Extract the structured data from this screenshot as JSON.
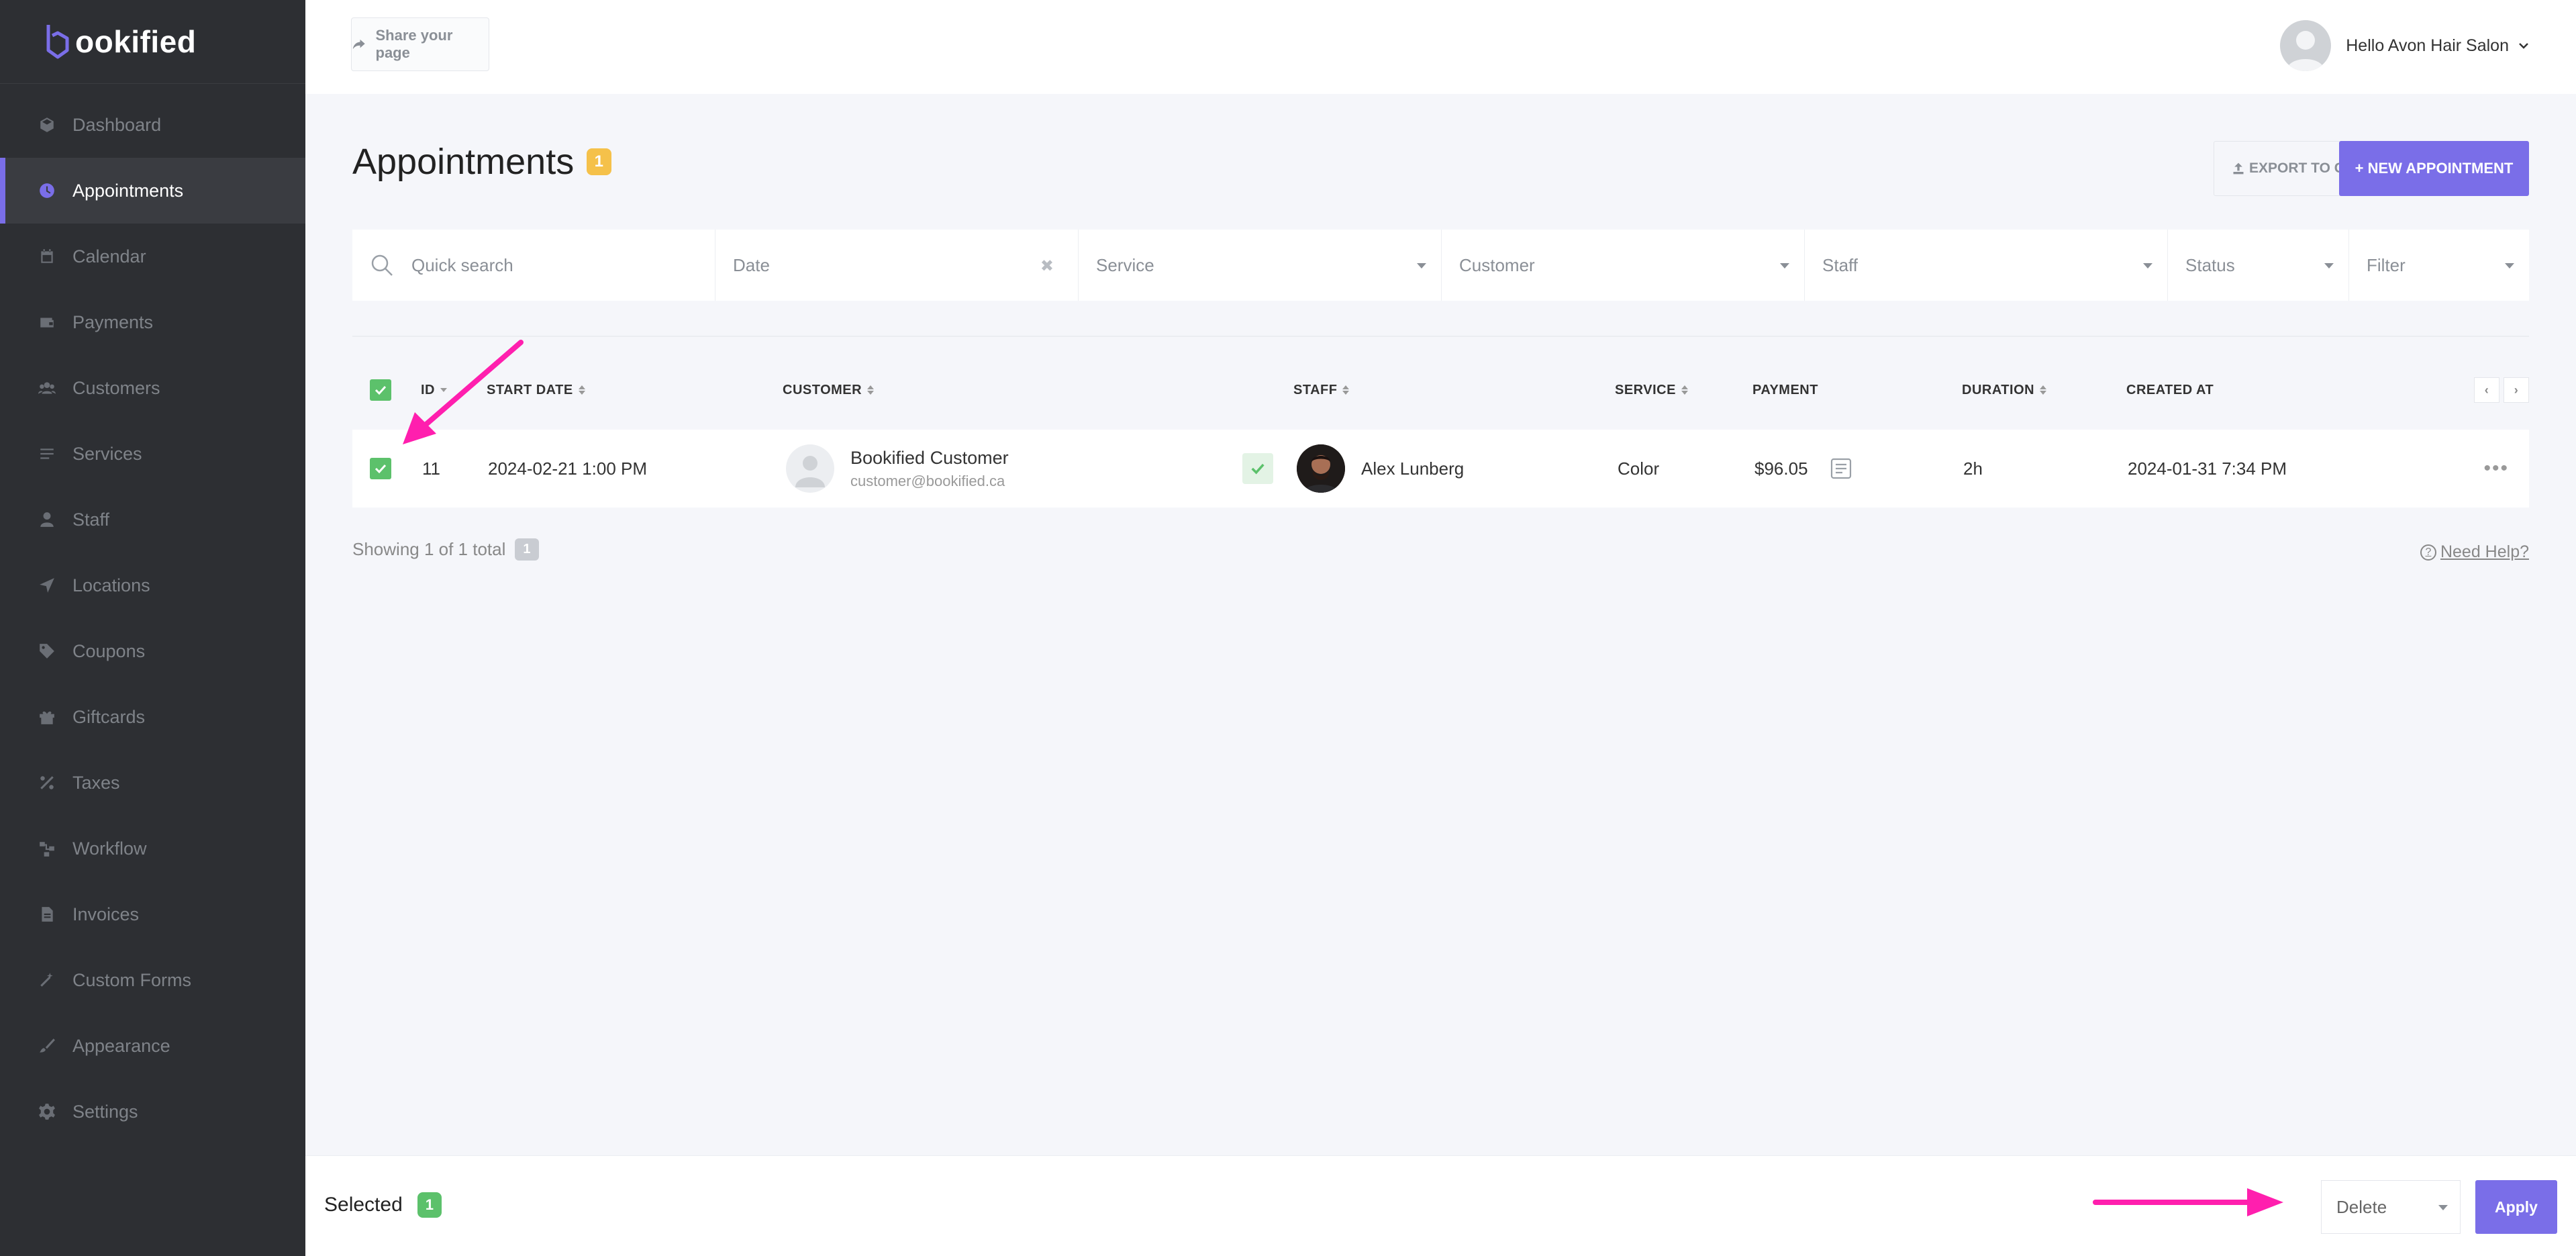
{
  "app": {
    "logo_text": "ookified",
    "brand_color": "#7a6ee8"
  },
  "sidebar": {
    "items": [
      {
        "label": "Dashboard",
        "icon": "cube-icon"
      },
      {
        "label": "Appointments",
        "icon": "clock-icon",
        "active": true
      },
      {
        "label": "Calendar",
        "icon": "calendar-icon"
      },
      {
        "label": "Payments",
        "icon": "wallet-icon"
      },
      {
        "label": "Customers",
        "icon": "users-icon"
      },
      {
        "label": "Services",
        "icon": "list-icon"
      },
      {
        "label": "Staff",
        "icon": "user-icon"
      },
      {
        "label": "Locations",
        "icon": "location-arrow-icon"
      },
      {
        "label": "Coupons",
        "icon": "tag-icon"
      },
      {
        "label": "Giftcards",
        "icon": "gift-icon"
      },
      {
        "label": "Taxes",
        "icon": "percent-icon"
      },
      {
        "label": "Workflow",
        "icon": "workflow-icon"
      },
      {
        "label": "Invoices",
        "icon": "file-icon"
      },
      {
        "label": "Custom Forms",
        "icon": "magic-wand-icon"
      },
      {
        "label": "Appearance",
        "icon": "brush-icon"
      },
      {
        "label": "Settings",
        "icon": "gear-icon"
      }
    ]
  },
  "topbar": {
    "share_label": "Share your page",
    "user_greeting": "Hello Avon Hair Salon"
  },
  "page": {
    "title": "Appointments",
    "count": "1",
    "export_label": "EXPORT TO CSV",
    "new_label": "+ NEW APPOINTMENT"
  },
  "filters": {
    "search_placeholder": "Quick search",
    "date_placeholder": "Date",
    "date_clear": "✖",
    "service": "Service",
    "customer": "Customer",
    "staff": "Staff",
    "status": "Status",
    "filter": "Filter"
  },
  "table": {
    "columns": {
      "id": "ID",
      "start_date": "START DATE",
      "customer": "CUSTOMER",
      "staff": "STAFF",
      "service": "SERVICE",
      "payment": "PAYMENT",
      "duration": "DURATION",
      "created_at": "CREATED AT"
    },
    "pager_prev": "‹",
    "pager_next": "›",
    "rows": [
      {
        "id": "11",
        "start_date": "2024-02-21 1:00 PM",
        "customer_name": "Bookified Customer",
        "customer_email": "customer@bookified.ca",
        "staff": "Alex Lunberg",
        "service": "Color",
        "payment": "$96.05",
        "duration": "2h",
        "created_at": "2024-01-31 7:34 PM",
        "menu": "•••"
      }
    ]
  },
  "footer": {
    "showing": "Showing 1 of 1 total",
    "showing_count": "1",
    "help": "Need Help?",
    "help_icon": "?"
  },
  "bulk": {
    "selected_label": "Selected",
    "selected_count": "1",
    "action": "Delete",
    "apply": "Apply"
  },
  "colors": {
    "sidebar_bg": "#2d2f33",
    "accent": "#7a6ee8",
    "success": "#5cc16b",
    "warning": "#f5c14a",
    "annotation": "#ff1fae"
  }
}
